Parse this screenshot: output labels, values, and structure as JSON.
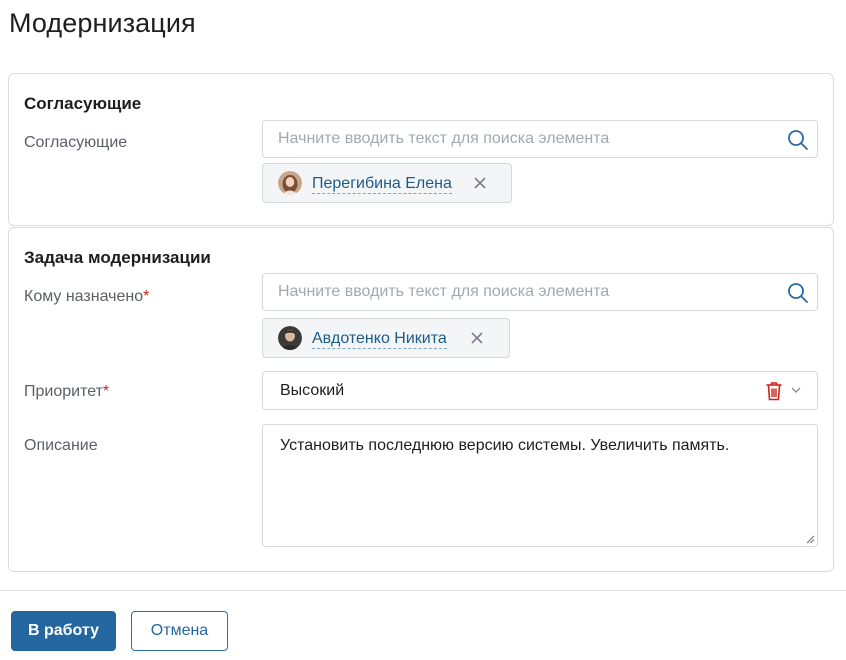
{
  "page": {
    "title": "Модернизация"
  },
  "approvers_section": {
    "title": "Согласующие",
    "field_label": "Согласующие",
    "search_placeholder": "Начните вводить текст для поиска элемента",
    "selected": {
      "name": "Перегибина Елена"
    }
  },
  "task_section": {
    "title": "Задача модернизации",
    "assignee": {
      "label": "Кому назначено",
      "required_mark": "*",
      "search_placeholder": "Начните вводить текст для поиска элемента",
      "selected": {
        "name": "Авдотенко Никита"
      }
    },
    "priority": {
      "label": "Приоритет",
      "required_mark": "*",
      "value": "Высокий"
    },
    "description": {
      "label": "Описание",
      "value": "Установить последнюю версию системы. Увеличить память."
    }
  },
  "footer": {
    "submit_label": "В работу",
    "cancel_label": "Отмена"
  },
  "colors": {
    "primary": "#2366a0",
    "link": "#1d5b8a",
    "required": "#d0211c",
    "trash": "#d0211c"
  },
  "icons": [
    "search-icon",
    "close-icon",
    "trash-icon",
    "chevron-down-icon",
    "resize-handle-icon"
  ]
}
